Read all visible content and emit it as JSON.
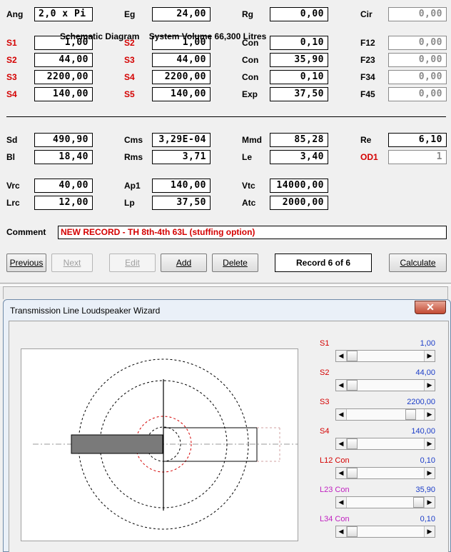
{
  "params": {
    "ang": {
      "label": "Ang",
      "value": "2,0 x Pi"
    },
    "eg": {
      "label": "Eg",
      "value": "24,00"
    },
    "rg": {
      "label": "Rg",
      "value": "0,00"
    },
    "cir": {
      "label": "Cir",
      "value": "0,00"
    },
    "s1": {
      "label": "S1",
      "value": "1,00"
    },
    "s2a": {
      "label": "S2",
      "value": "1,00"
    },
    "con1": {
      "label": "Con",
      "value": "0,10"
    },
    "f12": {
      "label": "F12",
      "value": "0,00"
    },
    "s2": {
      "label": "S2",
      "value": "44,00"
    },
    "s3a": {
      "label": "S3",
      "value": "44,00"
    },
    "con2": {
      "label": "Con",
      "value": "35,90"
    },
    "f23": {
      "label": "F23",
      "value": "0,00"
    },
    "s3": {
      "label": "S3",
      "value": "2200,00"
    },
    "s4a": {
      "label": "S4",
      "value": "2200,00"
    },
    "con3": {
      "label": "Con",
      "value": "0,10"
    },
    "f34": {
      "label": "F34",
      "value": "0,00"
    },
    "s4": {
      "label": "S4",
      "value": "140,00"
    },
    "s5": {
      "label": "S5",
      "value": "140,00"
    },
    "exp": {
      "label": "Exp",
      "value": "37,50"
    },
    "f45": {
      "label": "F45",
      "value": "0,00"
    },
    "sd": {
      "label": "Sd",
      "value": "490,90"
    },
    "cms": {
      "label": "Cms",
      "value": "3,29E-04"
    },
    "mmd": {
      "label": "Mmd",
      "value": "85,28"
    },
    "re": {
      "label": "Re",
      "value": "6,10"
    },
    "bl": {
      "label": "Bl",
      "value": "18,40"
    },
    "rms": {
      "label": "Rms",
      "value": "3,71"
    },
    "le": {
      "label": "Le",
      "value": "3,40"
    },
    "od1": {
      "label": "OD1",
      "value": "1"
    },
    "vrc": {
      "label": "Vrc",
      "value": "40,00"
    },
    "ap1": {
      "label": "Ap1",
      "value": "140,00"
    },
    "vtc": {
      "label": "Vtc",
      "value": "14000,00"
    },
    "lrc": {
      "label": "Lrc",
      "value": "12,00"
    },
    "lp": {
      "label": "Lp",
      "value": "37,50"
    },
    "atc": {
      "label": "Atc",
      "value": "2000,00"
    }
  },
  "comment": {
    "label": "Comment",
    "value": "NEW RECORD - TH 8th-4th 63L (stuffing option)"
  },
  "buttons": {
    "previous": "Previous",
    "next": "Next",
    "edit": "Edit",
    "add": "Add",
    "delete": "Delete",
    "record": "Record 6 of 6",
    "calculate": "Calculate"
  },
  "wizard": {
    "title": "Transmission Line Loudspeaker Wizard",
    "close_icon": "close-icon",
    "schematic_label": "Schematic Diagram",
    "system_volume": "System Volume 66,300 Litres",
    "sliders": [
      {
        "label": "S1",
        "value": "1,00",
        "color": "#d40000",
        "level": 0.0
      },
      {
        "label": "S2",
        "value": "44,00",
        "color": "#d40000",
        "level": 0.0
      },
      {
        "label": "S3",
        "value": "2200,00",
        "color": "#d40000",
        "level": 0.88
      },
      {
        "label": "S4",
        "value": "140,00",
        "color": "#d40000",
        "level": 0.0
      },
      {
        "label": "L12  Con",
        "value": "0,10",
        "color": "#d40000",
        "level": 0.0
      },
      {
        "label": "L23  Con",
        "value": "35,90",
        "color": "#c020c0",
        "level": 1.0
      },
      {
        "label": "L34  Con",
        "value": "0,10",
        "color": "#c020c0",
        "level": 0.0
      }
    ]
  },
  "colors": {
    "label_red": "#d40000",
    "value_blue": "#1a3cc8",
    "magenta": "#c020c0"
  }
}
